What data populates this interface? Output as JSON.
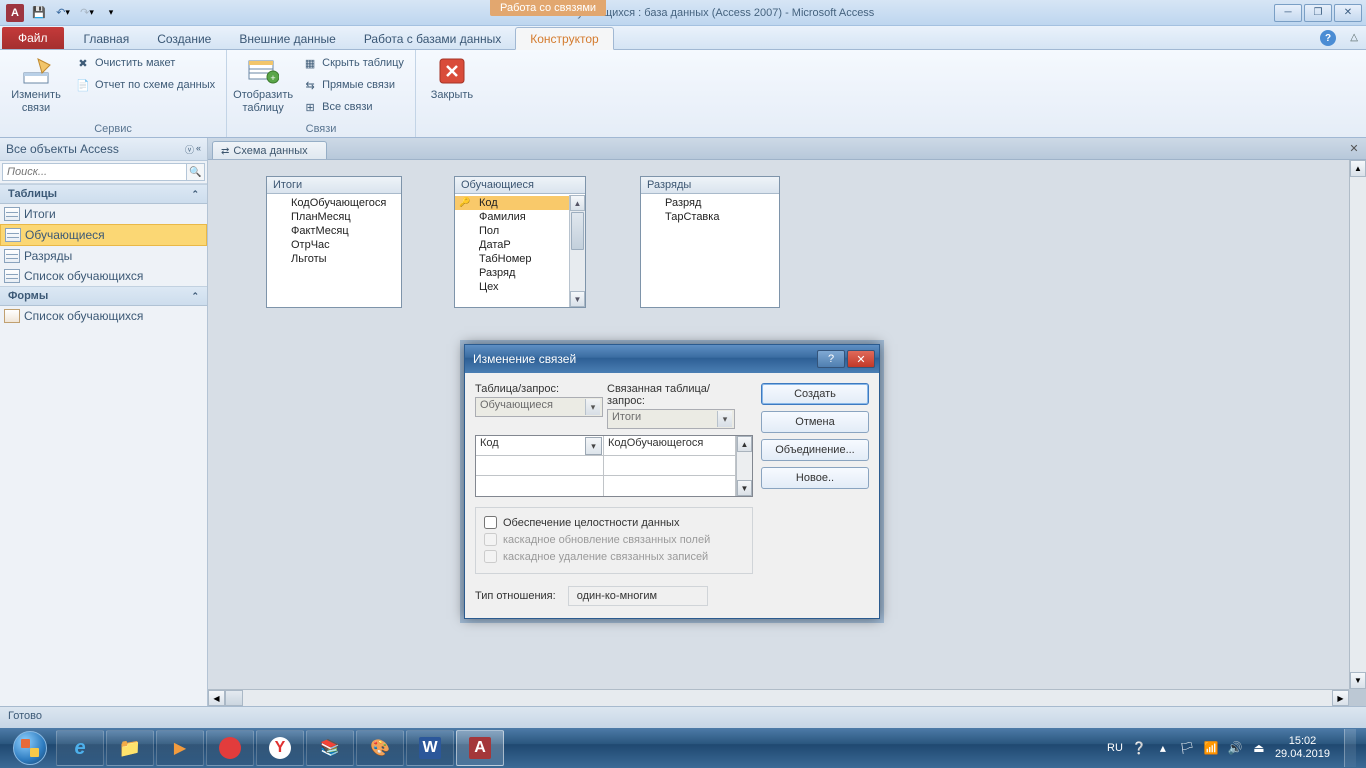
{
  "app": {
    "context_label": "Работа со связями",
    "title": "Список обучающихся : база данных (Access 2007)  -  Microsoft Access"
  },
  "tabs": {
    "file": "Файл",
    "home": "Главная",
    "create": "Создание",
    "external": "Внешние данные",
    "dbtools": "Работа с базами данных",
    "designer": "Конструктор"
  },
  "ribbon": {
    "edit_rel": "Изменить связи",
    "clear_layout": "Очистить макет",
    "rel_report": "Отчет по схеме данных",
    "group_service": "Сервис",
    "show_table": "Отобразить таблицу",
    "hide_table": "Скрыть таблицу",
    "direct_rel": "Прямые связи",
    "all_rel": "Все связи",
    "group_rel": "Связи",
    "close": "Закрыть"
  },
  "doc_tab": "Схема данных",
  "nav": {
    "header": "Все объекты Access",
    "search_ph": "Поиск...",
    "group_tables": "Таблицы",
    "group_forms": "Формы",
    "tables": [
      "Итоги",
      "Обучающиеся",
      "Разряды",
      "Список обучающихся"
    ],
    "forms": [
      "Список обучающихся"
    ]
  },
  "boxes": {
    "itogi": {
      "title": "Итоги",
      "fields": [
        "КодОбучающегося",
        "ПланМесяц",
        "ФактМесяц",
        "ОтрЧас",
        "Льготы"
      ]
    },
    "obuch": {
      "title": "Обучающиеся",
      "fields": [
        "Код",
        "Фамилия",
        "Пол",
        "ДатаР",
        "ТабНомер",
        "Разряд",
        "Цех"
      ]
    },
    "razr": {
      "title": "Разряды",
      "fields": [
        "Разряд",
        "ТарСтавка"
      ]
    }
  },
  "dialog": {
    "title": "Изменение связей",
    "lbl_table": "Таблица/запрос:",
    "lbl_related": "Связанная таблица/запрос:",
    "combo_left": "Обучающиеся",
    "combo_right": "Итоги",
    "field_left": "Код",
    "field_right": "КодОбучающегося",
    "chk_integrity": "Обеспечение целостности данных",
    "chk_cascade_upd": "каскадное обновление связанных полей",
    "chk_cascade_del": "каскадное удаление связанных записей",
    "lbl_reltype": "Тип отношения:",
    "val_reltype": "один-ко-многим",
    "btn_create": "Создать",
    "btn_cancel": "Отмена",
    "btn_join": "Объединение...",
    "btn_new": "Новое.."
  },
  "status": "Готово",
  "tray": {
    "lang": "RU",
    "time": "15:02",
    "date": "29.04.2019"
  }
}
